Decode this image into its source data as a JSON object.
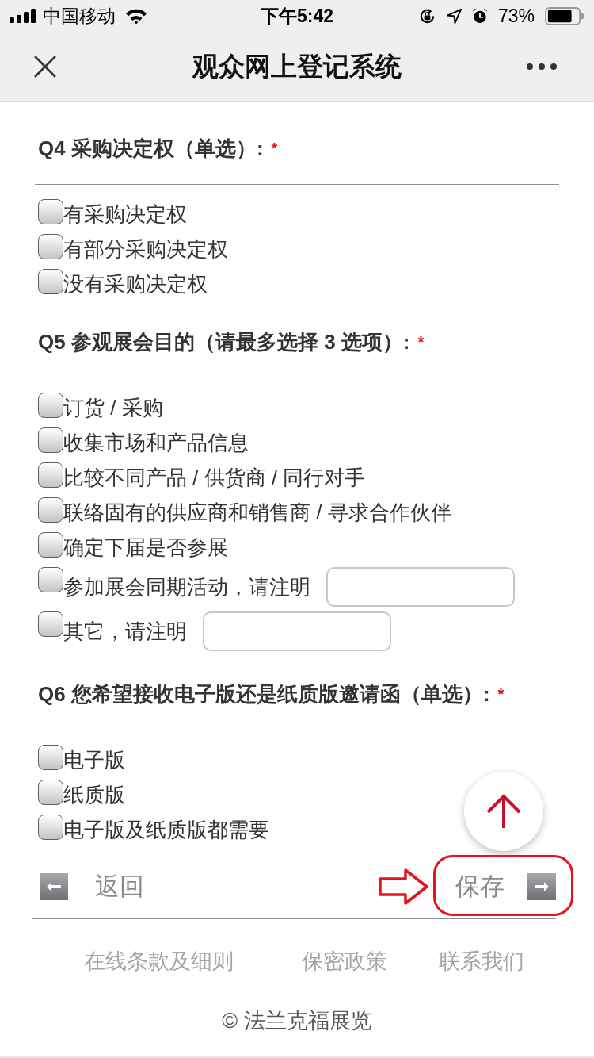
{
  "status_bar": {
    "carrier": "中国移动",
    "time": "下午5:42",
    "battery": "73%"
  },
  "nav_bar": {
    "title": "观众网上登记系统"
  },
  "questions": [
    {
      "heading": "Q4 采购决定权（单选）:",
      "required_mark": "*",
      "options": [
        {
          "kind": "plain",
          "label": "有采购决定权",
          "checked": false
        },
        {
          "kind": "plain",
          "label": "有部分采购决定权",
          "checked": false
        },
        {
          "kind": "plain",
          "label": "没有采购决定权",
          "checked": false
        }
      ]
    },
    {
      "heading": "Q5 参观展会目的（请最多选择 3 选项）:",
      "required_mark": "*",
      "options": [
        {
          "kind": "plain",
          "label": "订货 / 采购",
          "checked": false
        },
        {
          "kind": "plain",
          "label": "收集市场和产品信息",
          "checked": false
        },
        {
          "kind": "plain",
          "label": "比较不同产品 / 供货商 / 同行对手",
          "checked": false
        },
        {
          "kind": "plain",
          "label": "联络固有的供应商和销售商 / 寻求合作伙伴",
          "checked": false
        },
        {
          "kind": "plain",
          "label": "确定下届是否参展",
          "checked": false
        },
        {
          "kind": "with_field",
          "label": "参加展会同期活动，请注明",
          "checked": false
        },
        {
          "kind": "with_field",
          "label": "其它，请注明",
          "checked": false
        }
      ]
    },
    {
      "heading": "Q6 您希望接收电子版还是纸质版邀请函（单选）:",
      "required_mark": "*",
      "options": [
        {
          "kind": "plain",
          "label": "电子版",
          "checked": false
        },
        {
          "kind": "plain",
          "label": "纸质版",
          "checked": false
        },
        {
          "kind": "plain",
          "label": "电子版及纸质版都需要",
          "checked": false
        }
      ]
    }
  ],
  "form_nav": {
    "back": {
      "label": "返回"
    },
    "save": {
      "label": "保存",
      "highlighted": true
    }
  },
  "footer": {
    "links": [
      "在线条款及细则",
      "保密政策",
      "联系我们"
    ],
    "copyright": "© 法兰克福展览"
  }
}
